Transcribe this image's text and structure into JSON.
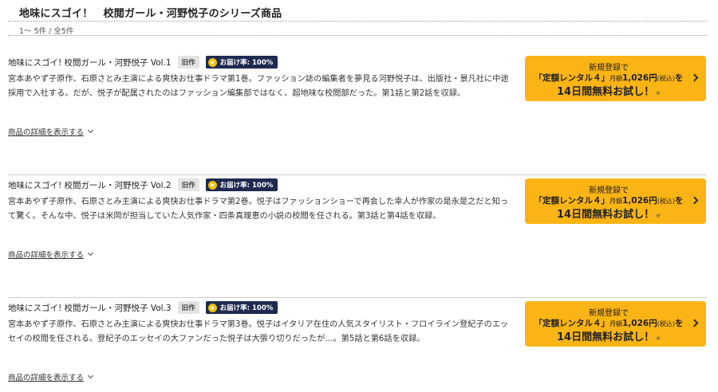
{
  "page": {
    "title": "地味にスゴイ！　校閲ガール・河野悦子のシリーズ商品",
    "count": "1～ 5件 / 全5件"
  },
  "items": [
    {
      "title": "地味にスゴイ! 校閲ガール・河野悦子 Vol.1",
      "badge_old": "旧作",
      "badge_rate": "お届け率: 100%",
      "desc": "宮本あやず子原作、石原さとみ主演による爽快お仕事ドラマ第1巻。ファッション誌の編集者を夢見る河野悦子は、出版社・景凡社に中途採用で入社する。だが、悦子が配属されたのはファッション編集部ではなく、超地味な校閲部だった。第1話と第2話を収録。",
      "detail_link": "商品の詳細を表示する",
      "cta": {
        "line1": "新規登録で",
        "line2_a": "「定額レンタル４」",
        "line2_small1": "月額",
        "line2_b": "1,026円",
        "line2_small2": "(税込)",
        "line2_c": "を",
        "line3": "14日間無料お試し！",
        "note": "※"
      }
    },
    {
      "title": "地味にスゴイ! 校閲ガール・河野悦子 Vol.2",
      "badge_old": "旧作",
      "badge_rate": "お届け率: 100%",
      "desc": "宮本あやず子原作、石原さとみ主演による爽快お仕事ドラマ第2巻。悦子はファッションショーで再会した幸人が作家の是永是之だと知って驚く。そんな中、悦子は米岡が担当していた人気作家・四条真理恵の小説の校閲を任される。第3話と第4話を収録。",
      "detail_link": "商品の詳細を表示する",
      "cta": {
        "line1": "新規登録で",
        "line2_a": "「定額レンタル４」",
        "line2_small1": "月額",
        "line2_b": "1,026円",
        "line2_small2": "(税込)",
        "line2_c": "を",
        "line3": "14日間無料お試し！",
        "note": "※"
      }
    },
    {
      "title": "地味にスゴイ! 校閲ガール・河野悦子 Vol.3",
      "badge_old": "旧作",
      "badge_rate": "お届け率: 100%",
      "desc": "宮本あやず子原作、石原さとみ主演による爽快お仕事ドラマ第3巻。悦子はイタリア在住の人気スタイリスト・フロイライン登紀子のエッセイの校閲を任される。登紀子のエッセイの大ファンだった悦子は大張り切りだったが…。第5話と第6話を収録。",
      "detail_link": "商品の詳細を表示する",
      "cta": {
        "line1": "新規登録で",
        "line2_a": "「定額レンタル４」",
        "line2_small1": "月額",
        "line2_b": "1,026円",
        "line2_small2": "(税込)",
        "line2_c": "を",
        "line3": "14日間無料お試し！",
        "note": "※"
      }
    }
  ],
  "colors": {
    "cta_bg": "#fbb415",
    "rate_badge_bg": "#1e2a50",
    "old_badge_bg": "#e4e4e4"
  }
}
